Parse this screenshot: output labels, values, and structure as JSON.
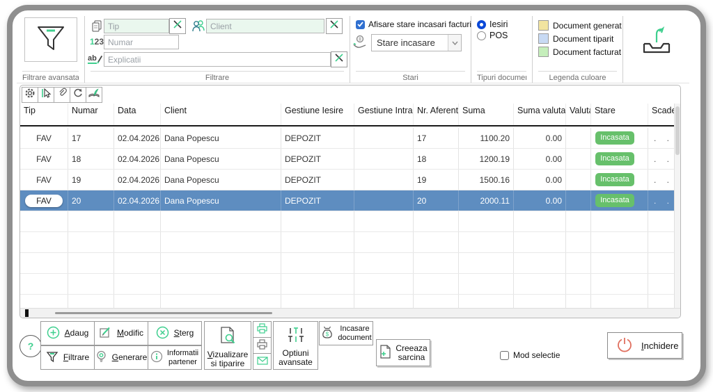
{
  "colors": {
    "accent": "#3ecf8e",
    "selected_row": "#5e8dc0",
    "badge_green": "#67c06b",
    "checkbox_blue": "#2f6fd0",
    "radio_blue": "#0b49d8",
    "power_red": "#e0705f",
    "legend_yellow": "#f2e4a0",
    "legend_blue": "#c8daf4",
    "legend_green": "#c5eebb"
  },
  "icons": {
    "numar_icon_text_accent": "1",
    "numar_icon_text_rest": "23",
    "explicatii_icon_text": "ab",
    "dollar": "$"
  },
  "toolbar": {
    "filtrare_avansata": {
      "label": "Filtrare avansata"
    },
    "filtrare": {
      "label": "Filtrare",
      "tip_placeholder": "Tip",
      "numar_placeholder": "Numar",
      "explicatii_placeholder": "Explicatii",
      "client_placeholder": "Client"
    },
    "stari": {
      "label": "Stari",
      "checkbox_label": "Afisare stare incasari facturi",
      "checkbox_checked": true,
      "dropdown_value": "Stare incasare"
    },
    "tipuri_documente": {
      "label": "Tipuri documente",
      "option_iesiri": "Iesiri",
      "option_pos": "POS",
      "selected": "Iesiri"
    },
    "legenda": {
      "label": "Legenda culoare",
      "items": [
        {
          "label": "Document generat"
        },
        {
          "label": "Document tiparit"
        },
        {
          "label": "Document facturat"
        }
      ]
    }
  },
  "table": {
    "columns": {
      "tip": "Tip",
      "numar": "Numar",
      "data": "Data",
      "client": "Client",
      "gestiune_iesire": "Gestiune Iesire",
      "gestiune_intrare": "Gestiune Intrare",
      "nr_aferent": "Nr. Aferent",
      "suma": "Suma",
      "suma_valuta": "Suma valuta",
      "valuta": "Valuta",
      "stare": "Stare",
      "scadenta": "Scade"
    },
    "rows": [
      {
        "tip": "FAV",
        "numar": "17",
        "data": "02.04.2026",
        "client": "Dana Popescu",
        "gestiune_iesire": "DEPOZIT",
        "gestiune_intrare": "",
        "nr_aferent": "17",
        "suma": "1100.20",
        "suma_valuta": "0.00",
        "valuta": "",
        "stare": "Incasata",
        "scadenta": ". ."
      },
      {
        "tip": "FAV",
        "numar": "18",
        "data": "02.04.2026",
        "client": "Dana Popescu",
        "gestiune_iesire": "DEPOZIT",
        "gestiune_intrare": "",
        "nr_aferent": "18",
        "suma": "1200.19",
        "suma_valuta": "0.00",
        "valuta": "",
        "stare": "Incasata",
        "scadenta": ". ."
      },
      {
        "tip": "FAV",
        "numar": "19",
        "data": "02.04.2026",
        "client": "Dana Popescu",
        "gestiune_iesire": "DEPOZIT",
        "gestiune_intrare": "",
        "nr_aferent": "19",
        "suma": "1500.16",
        "suma_valuta": "0.00",
        "valuta": "",
        "stare": "Incasata",
        "scadenta": ". ."
      },
      {
        "tip": "FAV",
        "numar": "20",
        "data": "02.04.2026",
        "client": "Dana Popescu",
        "gestiune_iesire": "DEPOZIT",
        "gestiune_intrare": "",
        "nr_aferent": "20",
        "suma": "2000.11",
        "suma_valuta": "0.00",
        "valuta": "",
        "stare": "Incasata",
        "scadenta": ". ."
      }
    ],
    "selected_row_index": 3
  },
  "bottom": {
    "help_label": "?",
    "adaug": "Adaug",
    "modific": "Modific",
    "sterg": "Sterg",
    "filtrare": "Filtrare",
    "generare": "Generare",
    "informatii_partener": "Informatii partener",
    "vizualizare": "Vizualizare si tiparire",
    "optiuni_avansate": "Optiuni avansate",
    "incasare_document": "Incasare document",
    "creeaza_sarcina": "Creeaza sarcina",
    "mod_selectie": "Mod selectie",
    "inchidere": "Inchidere"
  }
}
